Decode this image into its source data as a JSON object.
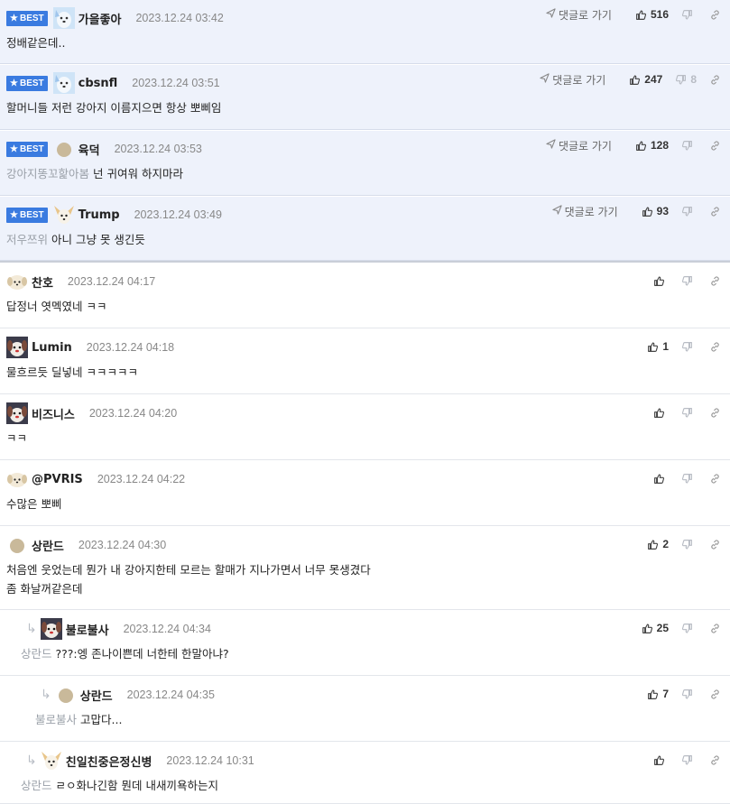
{
  "ui": {
    "best_label": "BEST",
    "goto_label": "댓글로 가기"
  },
  "comments": [
    {
      "best": true,
      "avatar": "dog-icon",
      "nick": "가을좋아",
      "date": "2023.12.24 03:42",
      "mention": "",
      "text": "정배같은데..",
      "likes": "516",
      "dislikes": "",
      "top": 0,
      "h": 72,
      "indent": 0
    },
    {
      "best": true,
      "avatar": "dog-icon",
      "nick": "cbsnfl",
      "date": "2023.12.24 03:51",
      "mention": "",
      "text": "할머니들 저런 강아지 이름지으면 항상 뽀삐임",
      "likes": "247",
      "dislikes": "8"
    },
    {
      "best": true,
      "avatar": "circle-avatar-icon",
      "nick": "육덕",
      "date": "2023.12.24 03:53",
      "mention": "강아지똥꼬핥아봄",
      "text": "넌 귀여워 하지마라",
      "likes": "128",
      "dislikes": ""
    },
    {
      "best": true,
      "avatar": "chihuahua-icon",
      "nick": "Trump",
      "date": "2023.12.24 03:49",
      "mention": "저우쯔위",
      "text": "아니 그냥 못 생긴듯",
      "likes": "93",
      "dislikes": ""
    },
    {
      "best": false,
      "avatar": "puppy-icon",
      "nick": "찬호",
      "date": "2023.12.24 04:17",
      "mention": "",
      "text": "답정너 엿멕였네 ㅋㅋ",
      "likes": "",
      "dislikes": ""
    },
    {
      "best": false,
      "avatar": "dog-face-icon",
      "nick": "Lumin",
      "date": "2023.12.24 04:18",
      "mention": "",
      "text": "물흐르듯 딜넣네 ㅋㅋㅋㅋㅋ",
      "likes": "1",
      "dislikes": ""
    },
    {
      "best": false,
      "avatar": "dog-face-icon",
      "nick": "비즈니스",
      "date": "2023.12.24 04:20",
      "mention": "",
      "text": "ㅋㅋ",
      "likes": "",
      "dislikes": ""
    },
    {
      "best": false,
      "avatar": "puppy-icon",
      "nick": "@PVRIS",
      "date": "2023.12.24 04:22",
      "mention": "",
      "text": "수많은 뽀삐",
      "likes": "",
      "dislikes": ""
    },
    {
      "best": false,
      "avatar": "circle-avatar-icon",
      "nick": "상란드",
      "date": "2023.12.24 04:30",
      "mention": "",
      "text": "처음엔 웃었는데 뭔가 내 강아지한테 모르는 할매가 지나가면서 너무 못생겼다",
      "text2": "좀 화날꺼같은데",
      "likes": "2",
      "dislikes": ""
    },
    {
      "best": false,
      "avatar": "dog-face-icon",
      "nick": "불로불사",
      "date": "2023.12.24 04:34",
      "mention": "상란드",
      "text": "???:엥 존나이쁜데 너한테 한말아냐?",
      "likes": "25",
      "dislikes": ""
    },
    {
      "best": false,
      "avatar": "circle-avatar-icon",
      "nick": "상란드",
      "date": "2023.12.24 04:35",
      "mention": "불로불사",
      "text": "고맙다...",
      "likes": "7",
      "dislikes": ""
    },
    {
      "best": false,
      "avatar": "chihuahua-icon",
      "nick": "친일친중은정신병",
      "date": "2023.12.24 10:31",
      "mention": "상란드",
      "text": "ㄹㅇ화나긴함 뭔데 내새끼욕하는지",
      "likes": "",
      "dislikes": ""
    }
  ]
}
